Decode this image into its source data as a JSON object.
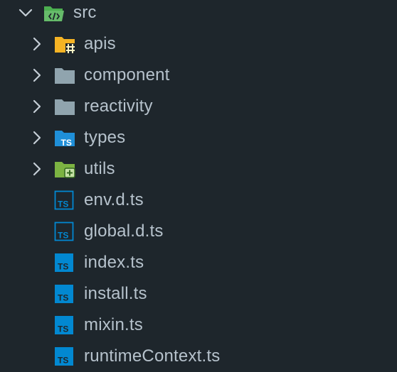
{
  "explorer": {
    "root": {
      "label": "src",
      "expanded": true,
      "icon": "folder-src-open-icon"
    },
    "folders": [
      {
        "label": "apis",
        "icon": "folder-api-icon",
        "color": "#f5b324"
      },
      {
        "label": "component",
        "icon": "folder-icon",
        "color": "#90a4ae"
      },
      {
        "label": "reactivity",
        "icon": "folder-icon",
        "color": "#90a4ae"
      },
      {
        "label": "types",
        "icon": "folder-typescript-icon",
        "color": "#1f8fd8"
      },
      {
        "label": "utils",
        "icon": "folder-utils-icon",
        "color": "#7cb342"
      }
    ],
    "files": [
      {
        "label": "env.d.ts",
        "icon": "typescript-def-icon"
      },
      {
        "label": "global.d.ts",
        "icon": "typescript-def-icon"
      },
      {
        "label": "index.ts",
        "icon": "typescript-icon"
      },
      {
        "label": "install.ts",
        "icon": "typescript-icon"
      },
      {
        "label": "mixin.ts",
        "icon": "typescript-icon"
      },
      {
        "label": "runtimeContext.ts",
        "icon": "typescript-icon"
      }
    ]
  },
  "colors": {
    "background": "#1e262c",
    "text": "#b6c2cc",
    "chevron": "#c5ced6",
    "src_folder": "#4caf50",
    "typescript": "#0288d1"
  }
}
